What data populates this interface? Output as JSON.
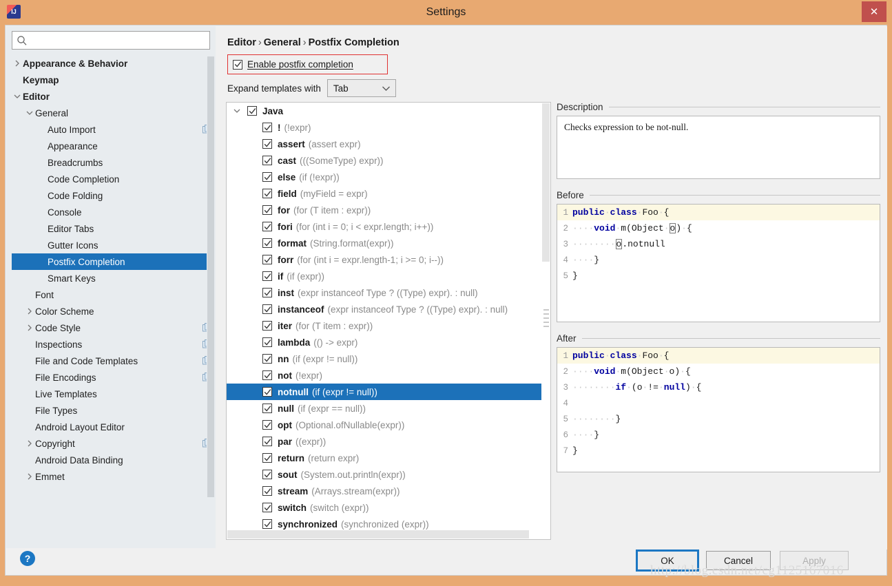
{
  "window": {
    "title": "Settings",
    "app_icon": "intellij-idea-icon",
    "close_label": "✕",
    "titlebar_color": "#e8a971",
    "close_color": "#c0504d"
  },
  "sidebar": {
    "search": {
      "placeholder": "",
      "value": "",
      "icon": "search-icon"
    },
    "items": [
      {
        "label": "Appearance & Behavior",
        "indent": 0,
        "arrow": "collapsed",
        "bold": true,
        "badge": false,
        "selected": false
      },
      {
        "label": "Keymap",
        "indent": 0,
        "arrow": "none",
        "bold": true,
        "badge": false,
        "selected": false
      },
      {
        "label": "Editor",
        "indent": 0,
        "arrow": "expanded",
        "bold": true,
        "badge": false,
        "selected": false
      },
      {
        "label": "General",
        "indent": 1,
        "arrow": "expanded",
        "bold": false,
        "badge": false,
        "selected": false
      },
      {
        "label": "Auto Import",
        "indent": 2,
        "arrow": "none",
        "bold": false,
        "badge": true,
        "selected": false
      },
      {
        "label": "Appearance",
        "indent": 2,
        "arrow": "none",
        "bold": false,
        "badge": false,
        "selected": false
      },
      {
        "label": "Breadcrumbs",
        "indent": 2,
        "arrow": "none",
        "bold": false,
        "badge": false,
        "selected": false
      },
      {
        "label": "Code Completion",
        "indent": 2,
        "arrow": "none",
        "bold": false,
        "badge": false,
        "selected": false
      },
      {
        "label": "Code Folding",
        "indent": 2,
        "arrow": "none",
        "bold": false,
        "badge": false,
        "selected": false
      },
      {
        "label": "Console",
        "indent": 2,
        "arrow": "none",
        "bold": false,
        "badge": false,
        "selected": false
      },
      {
        "label": "Editor Tabs",
        "indent": 2,
        "arrow": "none",
        "bold": false,
        "badge": false,
        "selected": false
      },
      {
        "label": "Gutter Icons",
        "indent": 2,
        "arrow": "none",
        "bold": false,
        "badge": false,
        "selected": false
      },
      {
        "label": "Postfix Completion",
        "indent": 2,
        "arrow": "none",
        "bold": false,
        "badge": false,
        "selected": true
      },
      {
        "label": "Smart Keys",
        "indent": 2,
        "arrow": "none",
        "bold": false,
        "badge": false,
        "selected": false
      },
      {
        "label": "Font",
        "indent": 1,
        "arrow": "none",
        "bold": false,
        "badge": false,
        "selected": false
      },
      {
        "label": "Color Scheme",
        "indent": 1,
        "arrow": "collapsed",
        "bold": false,
        "badge": false,
        "selected": false
      },
      {
        "label": "Code Style",
        "indent": 1,
        "arrow": "collapsed",
        "bold": false,
        "badge": true,
        "selected": false
      },
      {
        "label": "Inspections",
        "indent": 1,
        "arrow": "none",
        "bold": false,
        "badge": true,
        "selected": false
      },
      {
        "label": "File and Code Templates",
        "indent": 1,
        "arrow": "none",
        "bold": false,
        "badge": true,
        "selected": false
      },
      {
        "label": "File Encodings",
        "indent": 1,
        "arrow": "none",
        "bold": false,
        "badge": true,
        "selected": false
      },
      {
        "label": "Live Templates",
        "indent": 1,
        "arrow": "none",
        "bold": false,
        "badge": false,
        "selected": false
      },
      {
        "label": "File Types",
        "indent": 1,
        "arrow": "none",
        "bold": false,
        "badge": false,
        "selected": false
      },
      {
        "label": "Android Layout Editor",
        "indent": 1,
        "arrow": "none",
        "bold": false,
        "badge": false,
        "selected": false
      },
      {
        "label": "Copyright",
        "indent": 1,
        "arrow": "collapsed",
        "bold": false,
        "badge": true,
        "selected": false
      },
      {
        "label": "Android Data Binding",
        "indent": 1,
        "arrow": "none",
        "bold": false,
        "badge": false,
        "selected": false
      },
      {
        "label": "Emmet",
        "indent": 1,
        "arrow": "collapsed",
        "bold": false,
        "badge": false,
        "selected": false
      }
    ],
    "selection_color": "#1c71b9"
  },
  "main": {
    "breadcrumb": {
      "part1": "Editor",
      "sep": "›",
      "part2": "General",
      "part3": "Postfix Completion"
    },
    "enable_checkbox": {
      "label": "Enable postfix completion",
      "checked": true,
      "highlight_color": "#e03131"
    },
    "expand": {
      "label": "Expand templates with",
      "value": "Tab",
      "chevron": "chevron-down-icon"
    },
    "templates": [
      {
        "name": "Java",
        "desc": "",
        "group": true,
        "checked": true,
        "selected": false
      },
      {
        "name": "!",
        "desc": "(!expr)",
        "group": false,
        "checked": true,
        "selected": false
      },
      {
        "name": "assert",
        "desc": "(assert expr)",
        "group": false,
        "checked": true,
        "selected": false
      },
      {
        "name": "cast",
        "desc": "(((SomeType) expr))",
        "group": false,
        "checked": true,
        "selected": false
      },
      {
        "name": "else",
        "desc": "(if (!expr))",
        "group": false,
        "checked": true,
        "selected": false
      },
      {
        "name": "field",
        "desc": "(myField = expr)",
        "group": false,
        "checked": true,
        "selected": false
      },
      {
        "name": "for",
        "desc": "(for (T item : expr))",
        "group": false,
        "checked": true,
        "selected": false
      },
      {
        "name": "fori",
        "desc": "(for (int i = 0; i < expr.length; i++))",
        "group": false,
        "checked": true,
        "selected": false
      },
      {
        "name": "format",
        "desc": "(String.format(expr))",
        "group": false,
        "checked": true,
        "selected": false
      },
      {
        "name": "forr",
        "desc": "(for (int i = expr.length-1; i >= 0; i--))",
        "group": false,
        "checked": true,
        "selected": false
      },
      {
        "name": "if",
        "desc": "(if (expr))",
        "group": false,
        "checked": true,
        "selected": false
      },
      {
        "name": "inst",
        "desc": "(expr instanceof Type ? ((Type) expr). : null)",
        "group": false,
        "checked": true,
        "selected": false
      },
      {
        "name": "instanceof",
        "desc": "(expr instanceof Type ? ((Type) expr). : null)",
        "group": false,
        "checked": true,
        "selected": false
      },
      {
        "name": "iter",
        "desc": "(for (T item : expr))",
        "group": false,
        "checked": true,
        "selected": false
      },
      {
        "name": "lambda",
        "desc": "(() -> expr)",
        "group": false,
        "checked": true,
        "selected": false
      },
      {
        "name": "nn",
        "desc": "(if (expr != null))",
        "group": false,
        "checked": true,
        "selected": false
      },
      {
        "name": "not",
        "desc": "(!expr)",
        "group": false,
        "checked": true,
        "selected": false
      },
      {
        "name": "notnull",
        "desc": "(if (expr != null))",
        "group": false,
        "checked": true,
        "selected": true
      },
      {
        "name": "null",
        "desc": "(if (expr == null))",
        "group": false,
        "checked": true,
        "selected": false
      },
      {
        "name": "opt",
        "desc": "(Optional.ofNullable(expr))",
        "group": false,
        "checked": true,
        "selected": false
      },
      {
        "name": "par",
        "desc": "((expr))",
        "group": false,
        "checked": true,
        "selected": false
      },
      {
        "name": "return",
        "desc": "(return expr)",
        "group": false,
        "checked": true,
        "selected": false
      },
      {
        "name": "sout",
        "desc": "(System.out.println(expr))",
        "group": false,
        "checked": true,
        "selected": false
      },
      {
        "name": "stream",
        "desc": "(Arrays.stream(expr))",
        "group": false,
        "checked": true,
        "selected": false
      },
      {
        "name": "switch",
        "desc": "(switch (expr))",
        "group": false,
        "checked": true,
        "selected": false
      },
      {
        "name": "synchronized",
        "desc": "(synchronized (expr))",
        "group": false,
        "checked": true,
        "selected": false
      }
    ]
  },
  "detail": {
    "description_title": "Description",
    "description_text": "Checks expression to be not-null.",
    "before_title": "Before",
    "after_title": "After",
    "before_code": [
      {
        "n": "1",
        "highlight": true,
        "text": "public class Foo {"
      },
      {
        "n": "2",
        "highlight": false,
        "text": "    void m(Object o) {"
      },
      {
        "n": "3",
        "highlight": false,
        "text": "        o.notnull"
      },
      {
        "n": "4",
        "highlight": false,
        "text": "    }"
      },
      {
        "n": "5",
        "highlight": false,
        "text": "}"
      }
    ],
    "after_code": [
      {
        "n": "1",
        "highlight": true,
        "text": "public class Foo {"
      },
      {
        "n": "2",
        "highlight": false,
        "text": "    void m(Object o) {"
      },
      {
        "n": "3",
        "highlight": false,
        "text": "        if (o != null) {"
      },
      {
        "n": "4",
        "highlight": false,
        "text": ""
      },
      {
        "n": "5",
        "highlight": false,
        "text": "        }"
      },
      {
        "n": "6",
        "highlight": false,
        "text": "    }"
      },
      {
        "n": "7",
        "highlight": false,
        "text": "}"
      }
    ]
  },
  "footer": {
    "help_label": "?",
    "ok_label": "OK",
    "cancel_label": "Cancel",
    "apply_label": "Apply",
    "focus_color": "#1c77c3"
  },
  "watermark": "http://blog.csdn.net/cg1125167016"
}
